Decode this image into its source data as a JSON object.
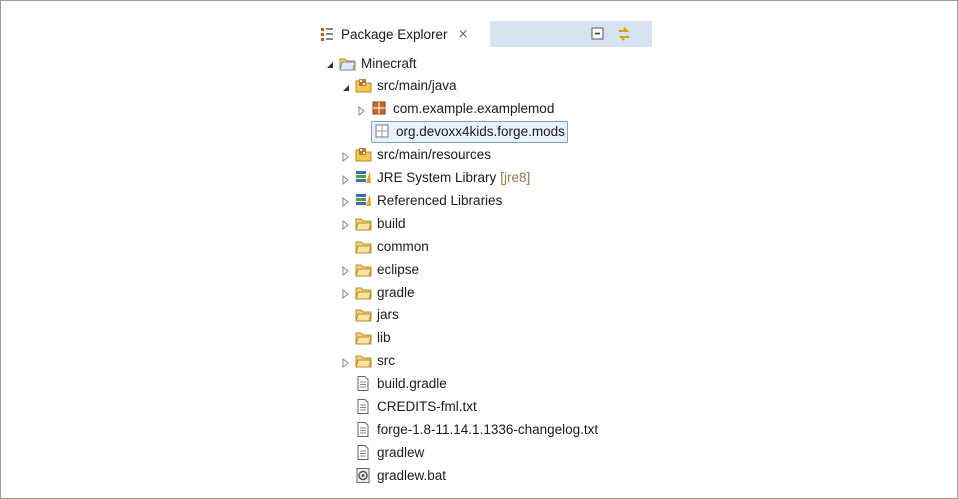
{
  "view": {
    "title": "Package Explorer",
    "close_glyph": "⨯",
    "icon": "package-explorer-icon",
    "toolbar": [
      {
        "name": "collapse-all-icon"
      },
      {
        "name": "link-with-editor-icon"
      }
    ]
  },
  "colors": {
    "toolbar_bg": "#d6e4f2",
    "selection_border": "#7da2ce",
    "selection_bg": "#e9f1fb",
    "folder_yellow": "#e8c15a",
    "package_brown": "#b5651d",
    "decoration": "#927a4b"
  },
  "tree": [
    {
      "label": "Minecraft",
      "icon": "project-folder-icon",
      "expanded": true,
      "depth": 0
    },
    {
      "label": "src/main/java",
      "icon": "source-folder-icon",
      "expanded": true,
      "depth": 1
    },
    {
      "label": "com.example.examplemod",
      "icon": "package-icon",
      "expanded": false,
      "depth": 2
    },
    {
      "label": "org.devoxx4kids.forge.mods",
      "icon": "empty-package-icon",
      "depth": 2,
      "selected": true
    },
    {
      "label": "src/main/resources",
      "icon": "source-folder-icon",
      "expanded": false,
      "depth": 1
    },
    {
      "label": "JRE System Library",
      "decoration": "[jre8]",
      "icon": "library-icon",
      "expanded": false,
      "depth": 1
    },
    {
      "label": "Referenced Libraries",
      "icon": "library-icon",
      "expanded": false,
      "depth": 1
    },
    {
      "label": "build",
      "icon": "folder-icon",
      "expanded": false,
      "depth": 1
    },
    {
      "label": "common",
      "icon": "folder-icon",
      "depth": 1
    },
    {
      "label": "eclipse",
      "icon": "folder-icon",
      "expanded": false,
      "depth": 1
    },
    {
      "label": "gradle",
      "icon": "folder-icon",
      "expanded": false,
      "depth": 1
    },
    {
      "label": "jars",
      "icon": "folder-icon",
      "depth": 1
    },
    {
      "label": "lib",
      "icon": "folder-icon",
      "depth": 1
    },
    {
      "label": "src",
      "icon": "folder-icon",
      "expanded": false,
      "depth": 1
    },
    {
      "label": "build.gradle",
      "icon": "file-icon",
      "depth": 1
    },
    {
      "label": "CREDITS-fml.txt",
      "icon": "file-icon",
      "depth": 1
    },
    {
      "label": "forge-1.8-11.14.1.1336-changelog.txt",
      "icon": "file-icon",
      "depth": 1
    },
    {
      "label": "gradlew",
      "icon": "file-icon",
      "depth": 1
    },
    {
      "label": "gradlew.bat",
      "icon": "bat-file-icon",
      "depth": 1
    }
  ]
}
